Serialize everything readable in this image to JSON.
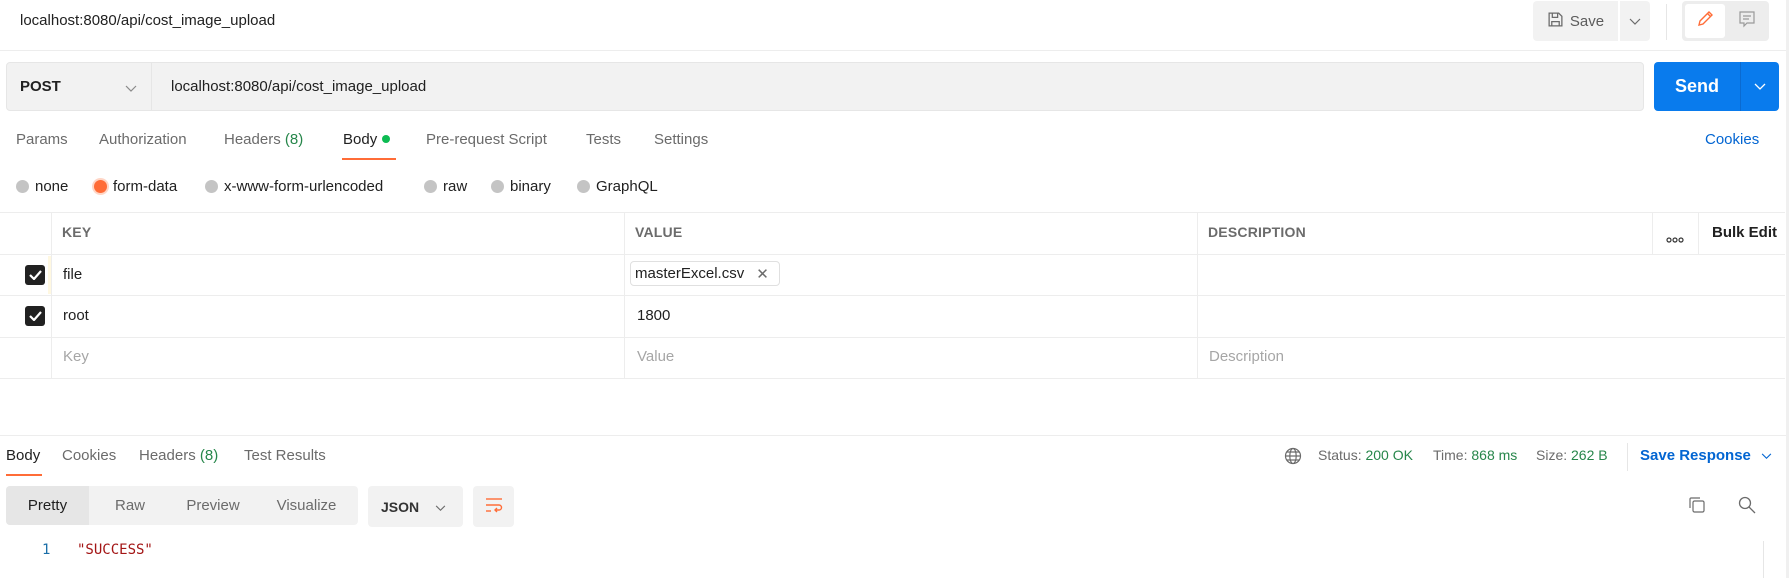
{
  "header": {
    "title": "localhost:8080/api/cost_image_upload",
    "save_label": "Save"
  },
  "request": {
    "method": "POST",
    "url": "localhost:8080/api/cost_image_upload",
    "send_label": "Send"
  },
  "request_tabs": [
    {
      "label": "Params"
    },
    {
      "label": "Authorization"
    },
    {
      "label": "Headers",
      "count": "(8)"
    },
    {
      "label": "Body",
      "active": true,
      "indicator": "green-dot"
    },
    {
      "label": "Pre-request Script"
    },
    {
      "label": "Tests"
    },
    {
      "label": "Settings"
    }
  ],
  "cookies_label": "Cookies",
  "body_types": [
    {
      "label": "none"
    },
    {
      "label": "form-data",
      "selected": true
    },
    {
      "label": "x-www-form-urlencoded"
    },
    {
      "label": "raw"
    },
    {
      "label": "binary"
    },
    {
      "label": "GraphQL"
    }
  ],
  "params_table": {
    "columns": [
      "KEY",
      "VALUE",
      "DESCRIPTION"
    ],
    "bulk_edit_label": "Bulk Edit",
    "rows": [
      {
        "checked": true,
        "key": "file",
        "value": "masterExcel.csv",
        "value_type": "file",
        "description": ""
      },
      {
        "checked": true,
        "key": "root",
        "value": "1800",
        "value_type": "text",
        "description": ""
      }
    ],
    "placeholders": {
      "key": "Key",
      "value": "Value",
      "description": "Description"
    }
  },
  "response": {
    "tabs": [
      {
        "label": "Body",
        "active": true
      },
      {
        "label": "Cookies"
      },
      {
        "label": "Headers",
        "count": "(8)"
      },
      {
        "label": "Test Results"
      }
    ],
    "status_label": "Status:",
    "status_value": "200 OK",
    "time_label": "Time:",
    "time_value": "868 ms",
    "size_label": "Size:",
    "size_value": "262 B",
    "save_response_label": "Save Response",
    "view_modes": [
      {
        "label": "Pretty",
        "active": true
      },
      {
        "label": "Raw"
      },
      {
        "label": "Preview"
      },
      {
        "label": "Visualize"
      }
    ],
    "format": "JSON",
    "code_lines": [
      {
        "number": "1",
        "text": "\"SUCCESS\""
      }
    ]
  },
  "colors": {
    "accent": "#ff6c37",
    "primary": "#097bed",
    "link": "#0265d2",
    "success": "#26864a"
  }
}
